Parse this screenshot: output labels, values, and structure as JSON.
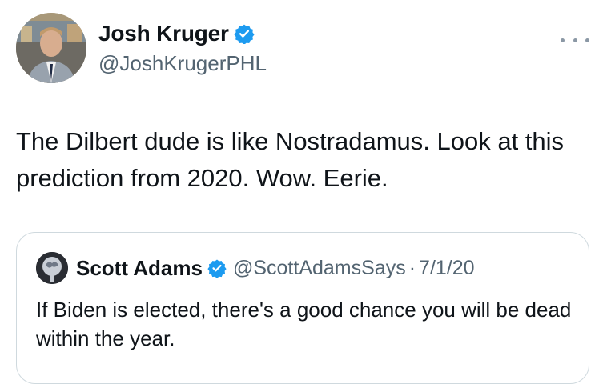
{
  "tweet": {
    "author_name": "Josh Kruger",
    "author_handle": "@JoshKrugerPHL",
    "text": "The Dilbert dude is like Nostradamus. Look at this prediction from 2020. Wow. Eerie."
  },
  "quote": {
    "author_name": "Scott Adams",
    "author_handle": "@ScottAdamsSays",
    "separator": "·",
    "date": "7/1/20",
    "text": "If Biden is elected, there's a good chance you will be dead within the year."
  },
  "icons": {
    "verified": "verified-badge-icon",
    "more": "more-options-icon"
  },
  "colors": {
    "verified_blue": "#1d9bf0",
    "secondary_text": "#536471",
    "border": "#cfd9de"
  }
}
